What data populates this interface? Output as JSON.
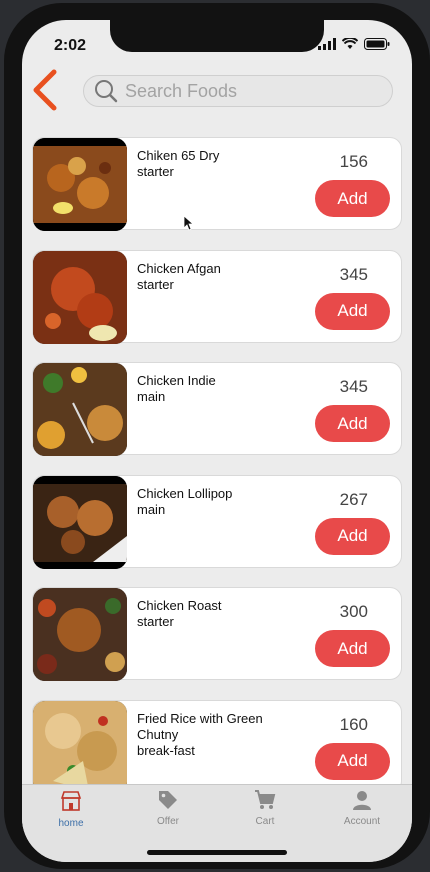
{
  "status_bar": {
    "time": "2:02"
  },
  "search": {
    "placeholder": "Search Foods"
  },
  "foods": [
    {
      "name": "Chiken 65 Dry",
      "category": "starter",
      "price": "156",
      "add_label": "Add"
    },
    {
      "name": "Chicken Afgan",
      "category": "starter",
      "price": "345",
      "add_label": "Add"
    },
    {
      "name": "Chicken Indie",
      "category": "main",
      "price": "345",
      "add_label": "Add"
    },
    {
      "name": "Chicken Lollipop",
      "category": "main",
      "price": "267",
      "add_label": "Add"
    },
    {
      "name": "Chicken Roast",
      "category": "starter",
      "price": "300",
      "add_label": "Add"
    },
    {
      "name": "Fried Rice with Green Chutny",
      "category": "break-fast",
      "price": "160",
      "add_label": "Add"
    }
  ],
  "nav": {
    "home": "home",
    "offer": "Offer",
    "cart": "Cart",
    "account": "Account"
  },
  "colors": {
    "accent": "#e84a4a",
    "back_arrow": "#e8501f",
    "active_nav": "#3d6fa8"
  }
}
